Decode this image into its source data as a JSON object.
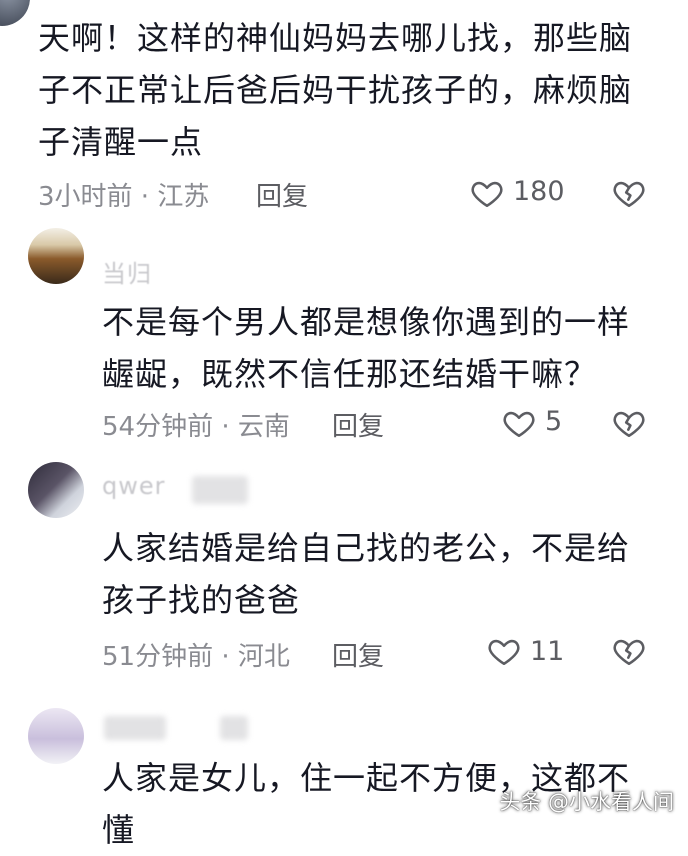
{
  "comments": [
    {
      "username": "",
      "content": "天啊！这样的神仙妈妈去哪儿找，那些脑\n子不正常让后爸后妈干扰孩子的，麻烦脑\n子清醒一点",
      "time": "3小时前",
      "location": "江苏",
      "reply_label": "回复",
      "like_count": "180"
    },
    {
      "username": "当归",
      "content": "不是每个男人都是想像你遇到的一样\n龌龊，既然不信任那还结婚干嘛？",
      "time": "54分钟前",
      "location": "云南",
      "reply_label": "回复",
      "like_count": "5"
    },
    {
      "username": "qwer",
      "content": "人家结婚是给自己找的老公，不是给\n孩子找的爸爸",
      "time": "51分钟前",
      "location": "河北",
      "reply_label": "回复",
      "like_count": "11"
    },
    {
      "username": "",
      "content": "人家是女儿，住一起不方便，这都不\n懂",
      "time": "",
      "location": "",
      "reply_label": "",
      "like_count": ""
    }
  ],
  "meta_separator": " · ",
  "watermark": "头条 @小水看人间",
  "icons": {
    "like": "heart-outline-icon",
    "dislike": "broken-heart-icon"
  },
  "colors": {
    "text": "#161823",
    "meta": "#8a8b91",
    "icon": "#5c5d62"
  }
}
